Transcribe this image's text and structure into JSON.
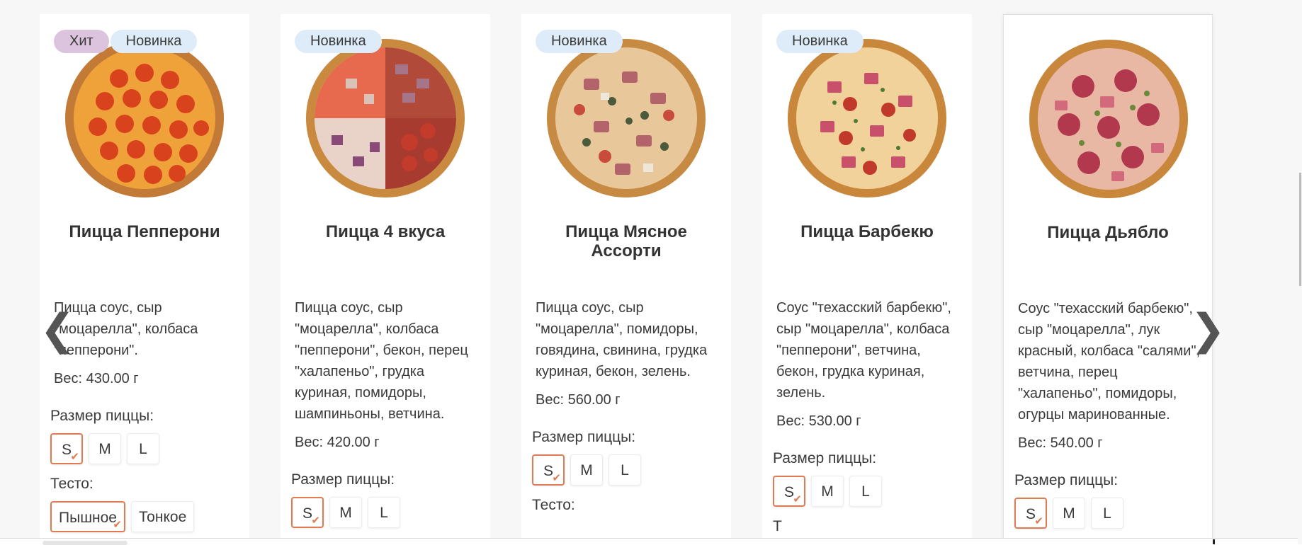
{
  "carousel": {
    "prev_icon": "chevron-left-icon",
    "next_icon": "chevron-right-icon",
    "prev_glyph": "❮",
    "next_glyph": "❯"
  },
  "colors": {
    "accent": "#e07a53",
    "badge_hit": "#dcc4de",
    "badge_new": "#ddecf8"
  },
  "products": [
    {
      "badges": [
        "Хит",
        "Новинка"
      ],
      "title": "Пицца Пепперони",
      "description": "Пицца соус, сыр \"моцарелла\", колбаса \"пепперони\".",
      "weight": "Вес: 430.00 г",
      "size_label": "Размер пиццы:",
      "sizes": [
        "S",
        "M",
        "L"
      ],
      "selected_size": "S",
      "dough_label": "Тесто:",
      "dough": [
        "Пышное",
        "Тонкое"
      ],
      "selected_dough": "Пышное"
    },
    {
      "badges": [
        "Новинка"
      ],
      "title": "Пицца 4 вкуса",
      "description": "Пицца соус, сыр \"моцарелла\", колбаса \"пепперони\", бекон, перец \"халапеньо\", грудка куриная, помидоры, шампиньоны, ветчина.",
      "weight": "Вес: 420.00 г",
      "size_label": "Размер пиццы:",
      "sizes": [
        "S",
        "M",
        "L"
      ],
      "selected_size": "S"
    },
    {
      "badges": [
        "Новинка"
      ],
      "title": "Пицца Мясное Ассорти",
      "description": "Пицца соус, сыр \"моцарелла\", помидоры, говядина, свинина, грудка куриная, бекон, зелень.",
      "weight": "Вес: 560.00 г",
      "size_label": "Размер пиццы:",
      "sizes": [
        "S",
        "M",
        "L"
      ],
      "selected_size": "S",
      "dough_label": "Тесто:"
    },
    {
      "badges": [
        "Новинка"
      ],
      "title": "Пицца Барбекю",
      "description": "Соус \"техасский барбекю\", сыр \"моцарелла\", колбаса \"пепперони\", ветчина, бекон, грудка куриная, зелень.",
      "weight": "Вес: 530.00 г",
      "size_label": "Размер пиццы:",
      "sizes": [
        "S",
        "M",
        "L"
      ],
      "selected_size": "S",
      "dough_label": "Т"
    },
    {
      "badges": [],
      "title": "Пицца Дьябло",
      "description": "Соус \"техасский барбекю\", сыр \"моцарелла\", лук красный, колбаса \"салями\", ветчина, перец \"халапеньо\", помидоры, огурцы маринованные.",
      "weight": "Вес: 540.00 г",
      "size_label": "Размер пиццы:",
      "sizes": [
        "S",
        "M",
        "L"
      ],
      "selected_size": "S"
    }
  ]
}
